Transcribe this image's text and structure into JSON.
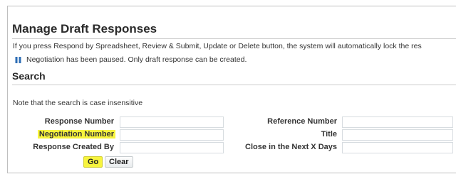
{
  "page": {
    "title": "Manage Draft Responses",
    "instruction": "If you press Respond by Spreadsheet, Review & Submit, Update or Delete button, the system will automatically lock the res",
    "info_message": "Negotiation has been paused. Only draft response can be created.",
    "info_icon": "pause-icon"
  },
  "search": {
    "title": "Search",
    "note": "Note that the search is case insensitive",
    "fields": {
      "response_number": {
        "label": "Response Number",
        "value": ""
      },
      "negotiation_number": {
        "label": "Negotiation Number",
        "value": "",
        "highlighted": true
      },
      "response_created_by": {
        "label": "Response Created By",
        "value": ""
      },
      "reference_number": {
        "label": "Reference Number",
        "value": ""
      },
      "title": {
        "label": "Title",
        "value": ""
      },
      "close_in_next_x_days": {
        "label": "Close in the Next X Days",
        "value": ""
      }
    },
    "buttons": {
      "go": "Go",
      "clear": "Clear"
    }
  },
  "colors": {
    "highlight": "#f7f43d",
    "info_icon": "#2d6db5",
    "rule": "#cccccc",
    "input_border": "#d7dce0"
  }
}
